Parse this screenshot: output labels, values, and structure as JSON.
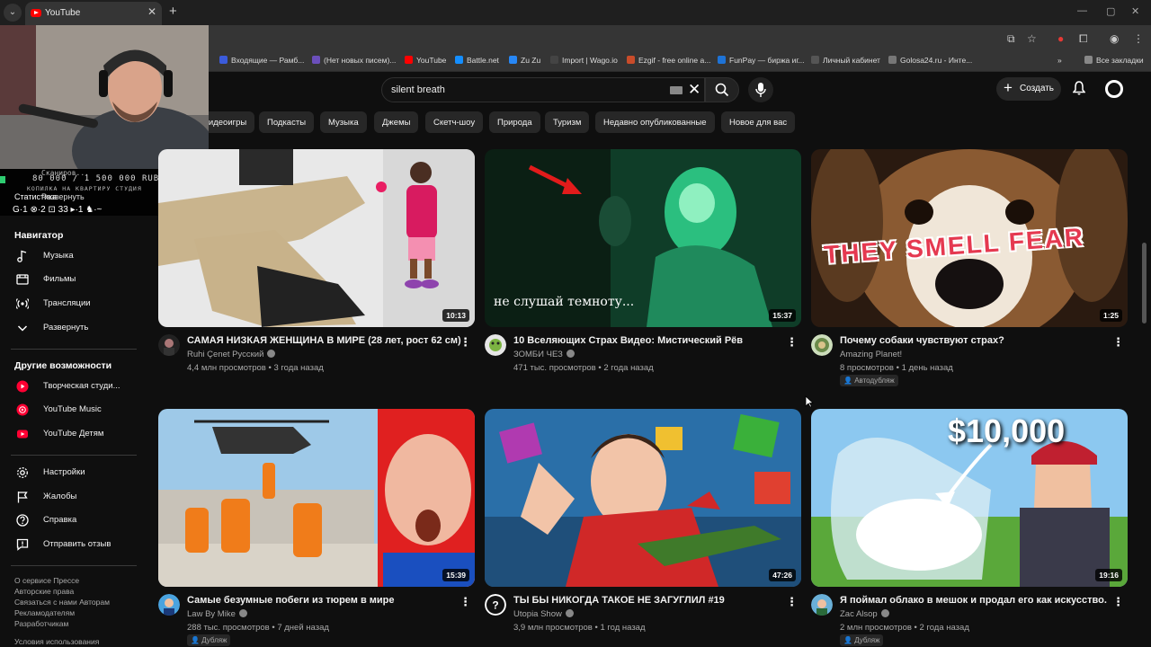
{
  "browser": {
    "tab_title": "YouTube",
    "bookmarks": [
      {
        "label": "Входящие — Рамб...",
        "color": "#3b5bdb"
      },
      {
        "label": "(Нет новых писем)...",
        "color": "#6b4fbb"
      },
      {
        "label": "YouTube",
        "color": "#ff0000"
      },
      {
        "label": "Battle.net",
        "color": "#148eff"
      },
      {
        "label": "Zu Zu",
        "color": "#2787f5"
      },
      {
        "label": "Import | Wago.io",
        "color": "#444444"
      },
      {
        "label": "Ezgif - free online a...",
        "color": "#c94c2a"
      },
      {
        "label": "FunPay — биржа иг...",
        "color": "#1e73d6"
      },
      {
        "label": "Личный кабинет",
        "color": "#555555"
      },
      {
        "label": "Golosa24.ru - Инте...",
        "color": "#777777"
      }
    ],
    "all_bookmarks": "Все закладки"
  },
  "header": {
    "search_value": "silent breath",
    "create_label": "Создать"
  },
  "chips": [
    "...идеоигры",
    "Подкасты",
    "Музыка",
    "Джемы",
    "Скетч-шоу",
    "Природа",
    "Туризм",
    "Недавно опубликованные",
    "Новое для вас"
  ],
  "overlay": {
    "counter_top": "80 000 / 1 500 000 RUB",
    "counter_sub": "КОПИЛКА НА КВАРТИРУ СТУДИЯ",
    "stat_label": "Статистика",
    "expand_label": "Развернуть",
    "stats_line": "G·1  ⊗·2  ⊡ 33  ▸·1  ♞·~",
    "scanning": "Сканиров..."
  },
  "sidebar": {
    "navigator_title": "Навигатор",
    "navigator": [
      {
        "label": "Музыка",
        "icon": "music-icon"
      },
      {
        "label": "Фильмы",
        "icon": "film-icon"
      },
      {
        "label": "Трансляции",
        "icon": "live-icon"
      },
      {
        "label": "Развернуть",
        "icon": "chevron-down-icon"
      }
    ],
    "more_title": "Другие возможности",
    "more": [
      {
        "label": "Творческая студи...",
        "icon": "studio-icon"
      },
      {
        "label": "YouTube Music",
        "icon": "yt-music-icon"
      },
      {
        "label": "YouTube Детям",
        "icon": "yt-kids-icon"
      }
    ],
    "settings": [
      {
        "label": "Настройки",
        "icon": "gear-icon"
      },
      {
        "label": "Жалобы",
        "icon": "flag-icon"
      },
      {
        "label": "Справка",
        "icon": "help-icon"
      },
      {
        "label": "Отправить отзыв",
        "icon": "feedback-icon"
      }
    ],
    "footer": {
      "line1": "О сервисе  Прессе",
      "line2": "Авторские права",
      "line3": "Связаться с нами  Авторам",
      "line4": "Рекламодателям",
      "line5": "Разработчикам",
      "line6": "Условия использования"
    }
  },
  "videos": [
    {
      "title": "САМАЯ НИЗКАЯ ЖЕНЩИНА В МИРЕ (28 лет, рост 62 см)",
      "channel": "Ruhi Çenet Русский",
      "views": "4,4 млн просмотров",
      "age": "3 года назад",
      "duration": "10:13",
      "badge": "",
      "thumb_text": ""
    },
    {
      "title": "10 Вселяющих Страх Видео: Мистический Рёв",
      "channel": "ЗОМБИ ЧЕЗ",
      "views": "471 тыс. просмотров",
      "age": "2 года назад",
      "duration": "15:37",
      "badge": "",
      "thumb_text": "не слушай темноту..."
    },
    {
      "title": "Почему собаки чувствуют страх?",
      "channel": "Amazing Planet!",
      "views": "8 просмотров",
      "age": "1 день назад",
      "duration": "1:25",
      "badge": "Автодубляж",
      "thumb_text": "THEY SMELL FEAR"
    },
    {
      "title": "Самые безумные побеги из тюрем в мире",
      "channel": "Law By Mike",
      "views": "288 тыс. просмотров",
      "age": "7 дней назад",
      "duration": "15:39",
      "badge": "Дубляж",
      "thumb_text": ""
    },
    {
      "title": "ТЫ БЫ НИКОГДА ТАКОЕ НЕ ЗАГУГЛИЛ #19",
      "channel": "Utopia Show",
      "views": "3,9 млн просмотров",
      "age": "1 год назад",
      "duration": "47:26",
      "badge": "",
      "thumb_text": ""
    },
    {
      "title": "Я поймал облако в мешок и продал его как искусство.",
      "channel": "Zac Alsop",
      "views": "2 млн просмотров",
      "age": "2 года назад",
      "duration": "19:16",
      "badge": "Дубляж",
      "thumb_text": "$10,000"
    }
  ]
}
